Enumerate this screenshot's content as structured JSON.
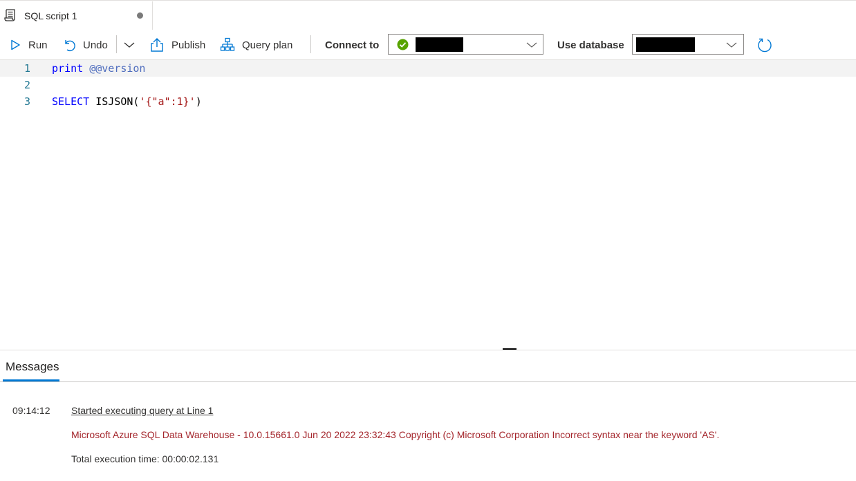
{
  "tab": {
    "title": "SQL script 1",
    "icon": "script-icon",
    "modified": true
  },
  "toolbar": {
    "run_label": "Run",
    "undo_label": "Undo",
    "publish_label": "Publish",
    "query_plan_label": "Query plan",
    "connect_to_label": "Connect to",
    "connect_to_value": "",
    "use_database_label": "Use database",
    "use_database_value": ""
  },
  "editor": {
    "lines": [
      {
        "number": "1",
        "tokens": [
          {
            "text": "print",
            "type": "keyword"
          },
          {
            "text": " ",
            "type": "plain"
          },
          {
            "text": "@@version",
            "type": "variable"
          }
        ]
      },
      {
        "number": "2",
        "tokens": []
      },
      {
        "number": "3",
        "tokens": [
          {
            "text": "SELECT",
            "type": "keyword"
          },
          {
            "text": " ISJSON(",
            "type": "plain"
          },
          {
            "text": "'{\"a\":1}'",
            "type": "string"
          },
          {
            "text": ")",
            "type": "plain"
          }
        ]
      }
    ]
  },
  "messages": {
    "tab_label": "Messages",
    "entries": {
      "time": "09:14:12",
      "started": "Started executing query at Line 1",
      "error": "Microsoft Azure SQL Data Warehouse - 10.0.15661.0 Jun 20 2022 23:32:43 Copyright (c) Microsoft Corporation Incorrect syntax near the keyword 'AS'.",
      "total": "Total execution time: 00:00:02.131"
    }
  },
  "colors": {
    "accent": "#0078d4",
    "error": "#a4262c",
    "keyword": "#0000ff",
    "string": "#a31515",
    "success": "#57a300"
  }
}
